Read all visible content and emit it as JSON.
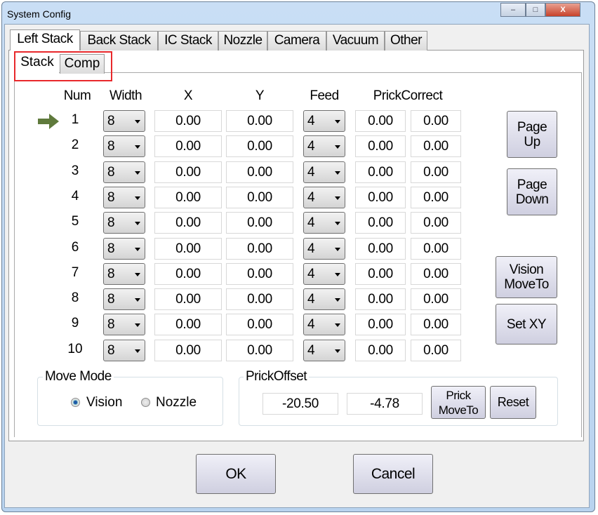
{
  "window": {
    "title": "System Config",
    "minimize": "–",
    "maximize": "□",
    "close": "X"
  },
  "tabs": [
    "Left Stack",
    "Back Stack",
    "IC Stack",
    "Nozzle",
    "Camera",
    "Vacuum",
    "Other"
  ],
  "subtabs": [
    "Stack",
    "Comp"
  ],
  "headers": {
    "num": "Num",
    "width": "Width",
    "x": "X",
    "y": "Y",
    "feed": "Feed",
    "prick": "PrickCorrect"
  },
  "rows": [
    {
      "num": "1",
      "width": "8",
      "x": "0.00",
      "y": "0.00",
      "feed": "4",
      "pc1": "0.00",
      "pc2": "0.00",
      "current": true
    },
    {
      "num": "2",
      "width": "8",
      "x": "0.00",
      "y": "0.00",
      "feed": "4",
      "pc1": "0.00",
      "pc2": "0.00"
    },
    {
      "num": "3",
      "width": "8",
      "x": "0.00",
      "y": "0.00",
      "feed": "4",
      "pc1": "0.00",
      "pc2": "0.00"
    },
    {
      "num": "4",
      "width": "8",
      "x": "0.00",
      "y": "0.00",
      "feed": "4",
      "pc1": "0.00",
      "pc2": "0.00"
    },
    {
      "num": "5",
      "width": "8",
      "x": "0.00",
      "y": "0.00",
      "feed": "4",
      "pc1": "0.00",
      "pc2": "0.00"
    },
    {
      "num": "6",
      "width": "8",
      "x": "0.00",
      "y": "0.00",
      "feed": "4",
      "pc1": "0.00",
      "pc2": "0.00"
    },
    {
      "num": "7",
      "width": "8",
      "x": "0.00",
      "y": "0.00",
      "feed": "4",
      "pc1": "0.00",
      "pc2": "0.00"
    },
    {
      "num": "8",
      "width": "8",
      "x": "0.00",
      "y": "0.00",
      "feed": "4",
      "pc1": "0.00",
      "pc2": "0.00"
    },
    {
      "num": "9",
      "width": "8",
      "x": "0.00",
      "y": "0.00",
      "feed": "4",
      "pc1": "0.00",
      "pc2": "0.00"
    },
    {
      "num": "10",
      "width": "8",
      "x": "0.00",
      "y": "0.00",
      "feed": "4",
      "pc1": "0.00",
      "pc2": "0.00"
    }
  ],
  "side_buttons": {
    "page_up": "Page\nUp",
    "page_down": "Page\nDown",
    "vision_moveto": "Vision\nMoveTo",
    "set_xy": "Set XY"
  },
  "move_mode": {
    "label": "Move Mode",
    "vision": "Vision",
    "nozzle": "Nozzle",
    "selected": "Vision"
  },
  "prick_offset": {
    "label": "PrickOffset",
    "x": "-20.50",
    "y": "-4.78",
    "moveto": "Prick\nMoveTo",
    "reset": "Reset"
  },
  "footer": {
    "ok": "OK",
    "cancel": "Cancel"
  },
  "colors": {
    "highlight": "#e8282b",
    "arrow": "#5f7a3c"
  },
  "icons": {
    "current_row": "arrow-right-icon"
  }
}
